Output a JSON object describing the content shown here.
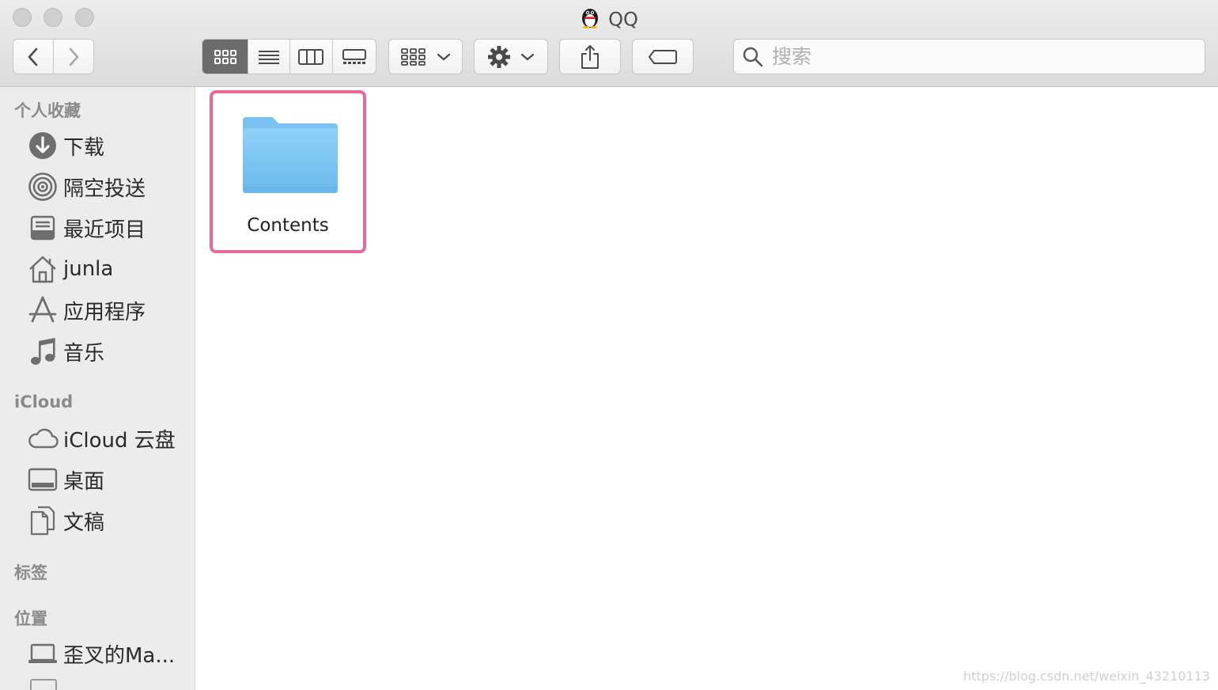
{
  "window": {
    "title": "QQ"
  },
  "toolbar": {
    "search_placeholder": "搜索"
  },
  "sidebar": {
    "favorites_header": "个人收藏",
    "favorites": [
      {
        "label": "下载",
        "icon": "download-icon"
      },
      {
        "label": "隔空投送",
        "icon": "airdrop-icon"
      },
      {
        "label": "最近项目",
        "icon": "recents-icon"
      },
      {
        "label": "junla",
        "icon": "home-icon"
      },
      {
        "label": "应用程序",
        "icon": "applications-icon"
      },
      {
        "label": "音乐",
        "icon": "music-icon"
      }
    ],
    "icloud_header": "iCloud",
    "icloud": [
      {
        "label": "iCloud 云盘",
        "icon": "cloud-icon"
      },
      {
        "label": "桌面",
        "icon": "desktop-icon"
      },
      {
        "label": "文稿",
        "icon": "documents-icon"
      }
    ],
    "tags_header": "标签",
    "locations_header": "位置",
    "locations": [
      {
        "label": "歪叉的Ma...",
        "icon": "laptop-icon"
      }
    ]
  },
  "content": {
    "items": [
      {
        "name": "Contents",
        "icon": "folder-icon",
        "selected": true
      }
    ]
  },
  "watermark": "https://blog.csdn.net/weixin_43210113",
  "colors": {
    "selection_border": "#e8689a",
    "folder_blue": "#7cc6f3",
    "sidebar_bg": "#ececec"
  }
}
